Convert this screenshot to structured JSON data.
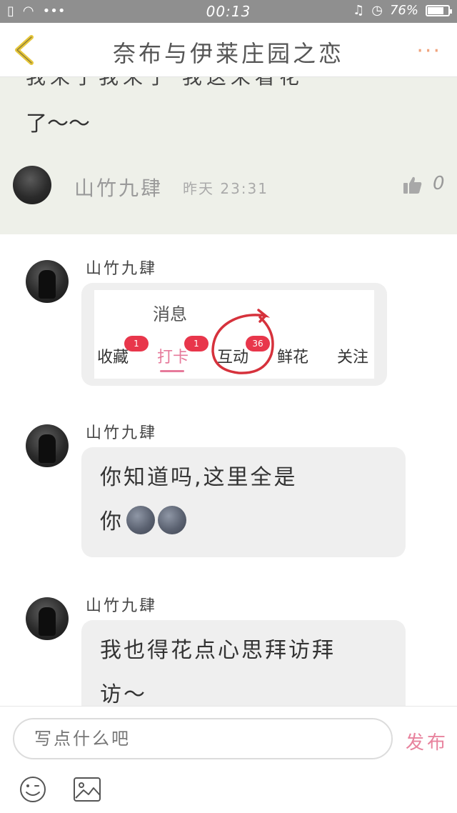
{
  "status_bar": {
    "time": "00:13",
    "battery": "76%",
    "battery_level": 0.76
  },
  "header": {
    "title": "奈布与伊莱庄园之恋",
    "more_label": "···"
  },
  "previous_message": {
    "cut_text": "我来了我来了  我这来看花",
    "text": "了～～",
    "author": "山竹九肆",
    "time": "昨天 23:31",
    "likes": "0"
  },
  "messages": [
    {
      "sender": "山竹九肆",
      "type": "image",
      "screenshot": {
        "title": "消息",
        "tabs": [
          {
            "label": "收藏",
            "badge": "1"
          },
          {
            "label": "打卡",
            "badge": "1"
          },
          {
            "label": "互动",
            "badge": "36"
          },
          {
            "label": "鲜花",
            "badge": ""
          },
          {
            "label": "关注",
            "badge": ""
          }
        ],
        "active_tab": "打卡",
        "highlight_color": "#d6323c"
      }
    },
    {
      "sender": "山竹九肆",
      "type": "text",
      "line1": "你知道吗,这里全是",
      "line2": "你",
      "emojis": [
        "new-moon-face",
        "new-moon-face"
      ]
    },
    {
      "sender": "山竹九肆",
      "type": "text",
      "line1": "我也得花点心思拜访拜",
      "line2": "访～"
    }
  ],
  "input_bar": {
    "placeholder": "写点什么吧",
    "send_label": "发布"
  },
  "colors": {
    "accent": "#e8839e",
    "back_icon": "#e6c63a",
    "more_icon": "#f0a37c",
    "badge": "#e8364b",
    "highlight_block": "#eef0e9",
    "bubble": "#efefef"
  }
}
